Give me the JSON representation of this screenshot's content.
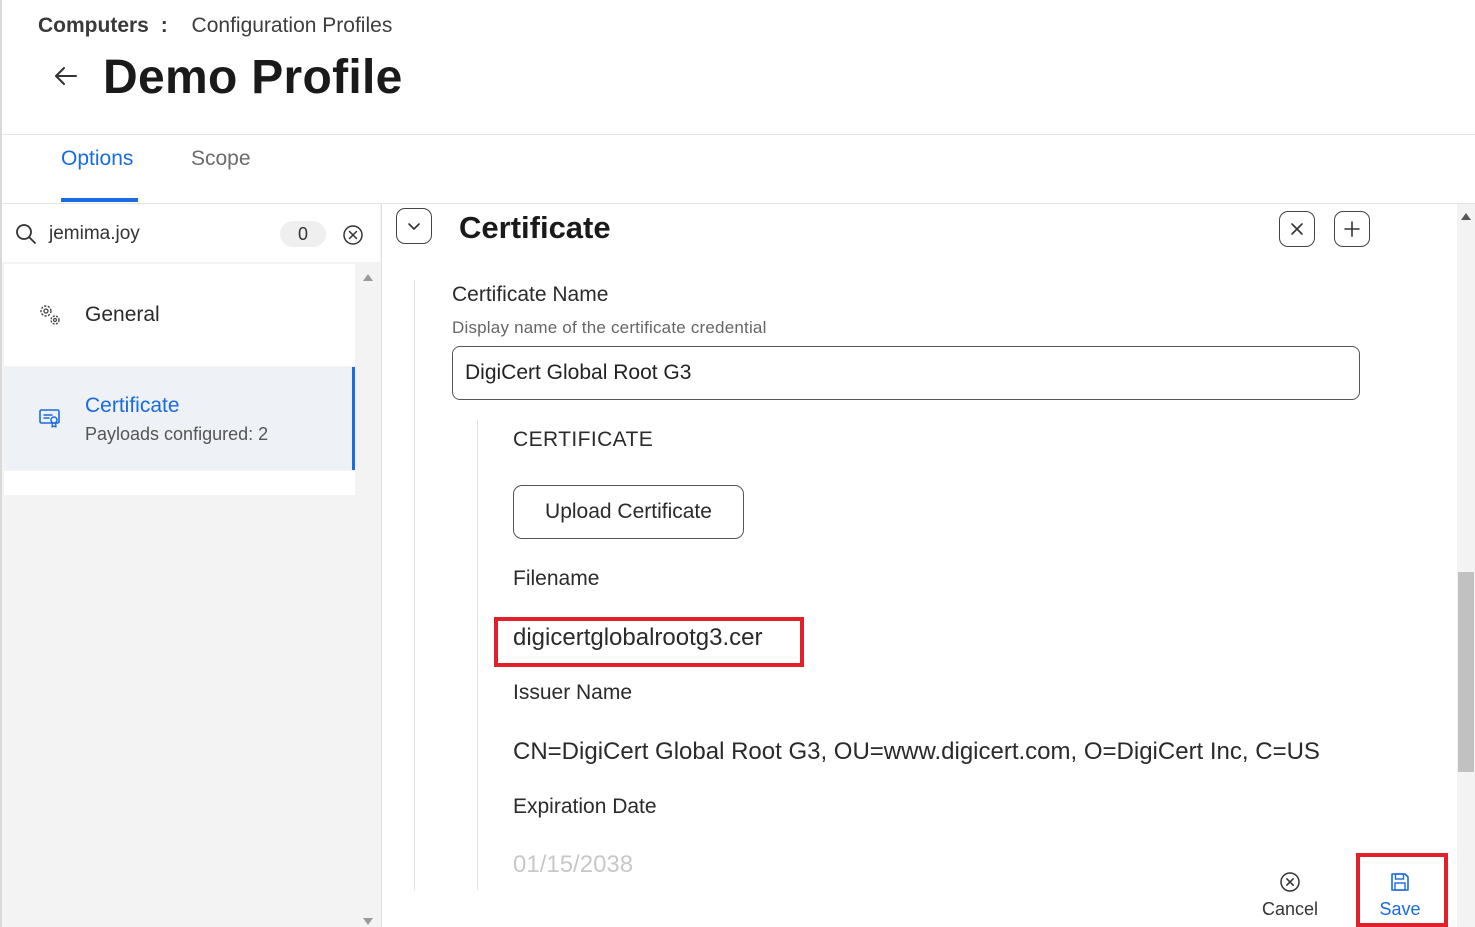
{
  "breadcrumb": {
    "root": "Computers",
    "separator": ":",
    "current": "Configuration Profiles"
  },
  "page": {
    "title": "Demo Profile",
    "back_icon": "arrow-left-icon"
  },
  "tabs": [
    {
      "label": "Options",
      "active": true
    },
    {
      "label": "Scope",
      "active": false
    }
  ],
  "sidebar": {
    "search": {
      "value": "jemima.joy",
      "count": "0"
    },
    "items": [
      {
        "label": "General",
        "icon": "gear-icon"
      },
      {
        "label": "Certificate",
        "sub": "Payloads configured: 2",
        "icon": "certificate-icon",
        "selected": true
      }
    ]
  },
  "section": {
    "title": "Certificate",
    "certificate_name": {
      "label": "Certificate Name",
      "hint": "Display name of the certificate credential",
      "value": "DigiCert Global Root G3"
    },
    "certificate_heading": "CERTIFICATE",
    "upload_label": "Upload Certificate",
    "filename": {
      "label": "Filename",
      "value": "digicertglobalrootg3.cer"
    },
    "issuer": {
      "label": "Issuer Name",
      "value": "CN=DigiCert Global Root G3, OU=www.digicert.com, O=DigiCert Inc, C=US"
    },
    "expiration": {
      "label": "Expiration Date",
      "value": "01/15/2038"
    }
  },
  "actions": {
    "cancel_label": "Cancel",
    "save_label": "Save"
  },
  "colors": {
    "accent": "#1a6be0",
    "highlight": "#e0202a"
  }
}
